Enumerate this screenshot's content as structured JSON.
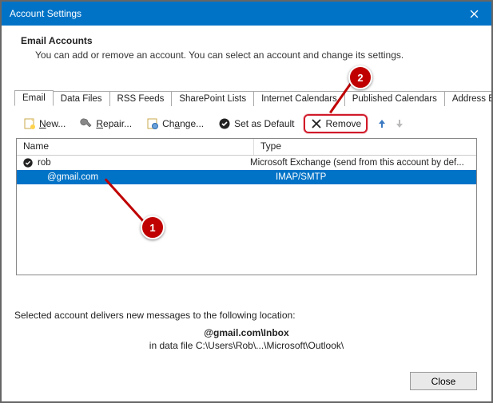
{
  "window": {
    "title": "Account Settings"
  },
  "header": {
    "title": "Email Accounts",
    "subtitle": "You can add or remove an account. You can select an account and change its settings."
  },
  "tabs": {
    "items": [
      {
        "label": "Email",
        "active": true
      },
      {
        "label": "Data Files"
      },
      {
        "label": "RSS Feeds"
      },
      {
        "label": "SharePoint Lists"
      },
      {
        "label": "Internet Calendars"
      },
      {
        "label": "Published Calendars"
      },
      {
        "label": "Address Books"
      }
    ]
  },
  "toolbar": {
    "new": "New...",
    "repair": "Repair...",
    "change": "Change...",
    "set_default": "Set as Default",
    "remove": "Remove"
  },
  "grid": {
    "col_name": "Name",
    "col_type": "Type",
    "rows": [
      {
        "name": "rob",
        "type": "Microsoft Exchange (send from this account by def...",
        "default": true,
        "selected": false,
        "indent": false
      },
      {
        "name": "@gmail.com",
        "type": "IMAP/SMTP",
        "default": false,
        "selected": true,
        "indent": true
      }
    ]
  },
  "footer": {
    "line1": "Selected account delivers new messages to the following location:",
    "line2": "@gmail.com\\Inbox",
    "line3": "in data file C:\\Users\\Rob\\...\\Microsoft\\Outlook\\"
  },
  "buttons": {
    "close": "Close"
  },
  "annotations": {
    "a1": "1",
    "a2": "2"
  }
}
